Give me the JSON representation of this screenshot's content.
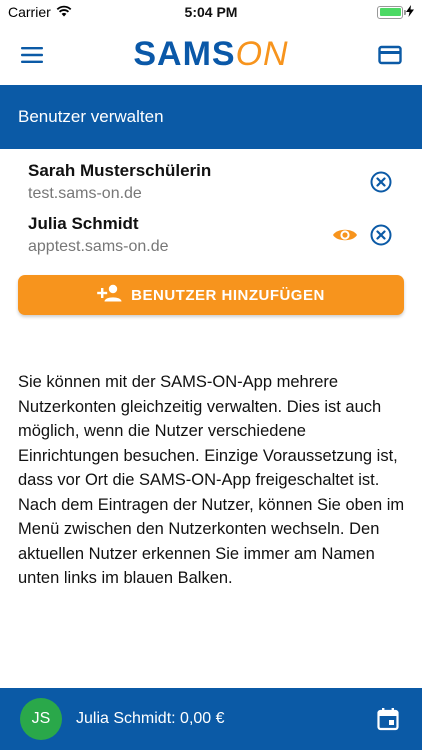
{
  "status_bar": {
    "carrier": "Carrier",
    "time": "5:04 PM"
  },
  "header": {
    "logo_part1": "SAMS",
    "logo_part2": "ON",
    "colors": {
      "brand_blue": "#0a58a8",
      "brand_orange": "#f7941d"
    }
  },
  "title_bar": {
    "title": "Benutzer verwalten"
  },
  "users": [
    {
      "name": "Sarah Musterschülerin",
      "host": "test.sams-on.de",
      "active": false
    },
    {
      "name": "Julia Schmidt",
      "host": "apptest.sams-on.de",
      "active": true
    }
  ],
  "add_button": {
    "label": "BENUTZER HINZUFÜGEN"
  },
  "description": "Sie können mit der SAMS-ON-App mehrere Nutzerkonten gleichzeitig verwalten. Dies ist auch möglich, wenn die Nutzer verschiedene Einrichtungen besuchen. Einzige Voraussetzung ist, dass vor Ort die SAMS-ON-App freigeschaltet ist. Nach dem Eintragen der Nutzer, können Sie oben im Menü zwischen den Nutzerkonten wechseln. Den aktuellen Nutzer erkennen Sie immer am Namen unten links im blauen Balken.",
  "bottom_bar": {
    "avatar_initials": "JS",
    "balance_text": "Julia Schmidt: 0,00 €"
  }
}
